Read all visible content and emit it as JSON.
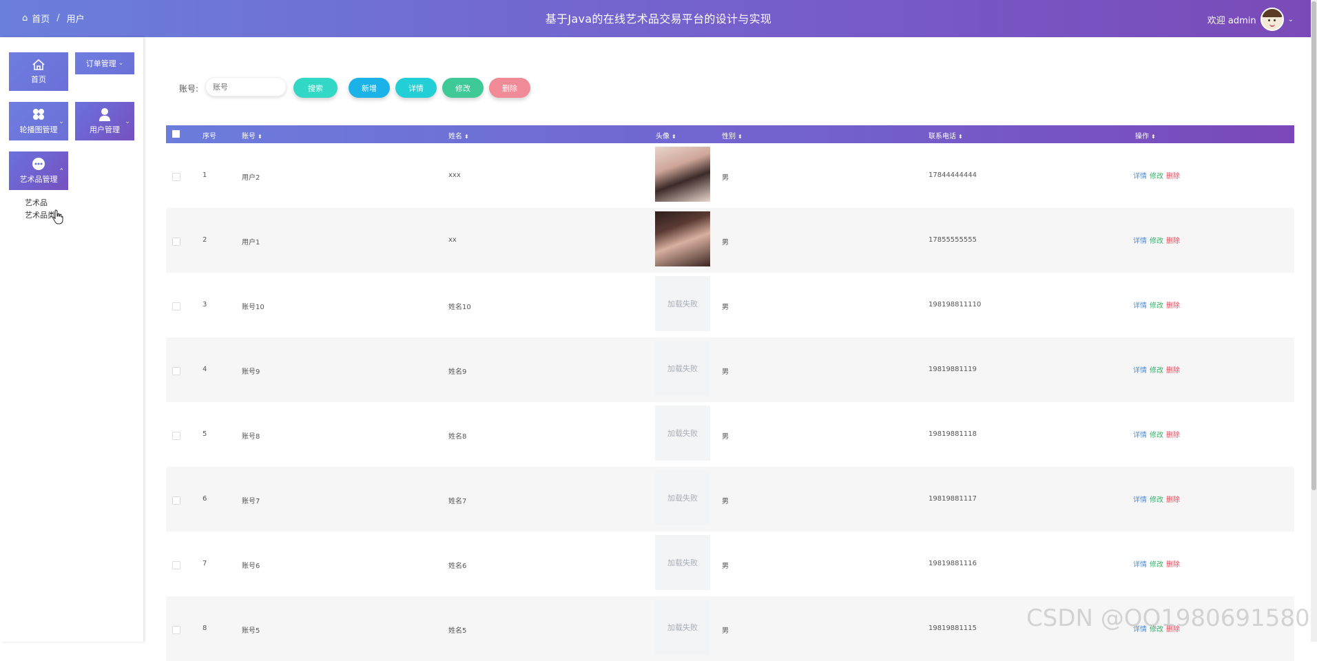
{
  "header": {
    "breadcrumb": {
      "home_glyph": "⌂",
      "home": "首页",
      "separator": "/",
      "current": "用户"
    },
    "title": "基于Java的在线艺术品交易平台的设计与实现",
    "welcome": "欢迎 admin",
    "caret": "⌄"
  },
  "sidebar": {
    "home": "首页",
    "orders": "订单管理",
    "carousel": "轮播图管理",
    "users": "用户管理",
    "artworks": "艺术品管理",
    "sub_items": [
      "艺术品",
      "艺术品类"
    ],
    "caret_down": "⌄",
    "caret_up": "⌃"
  },
  "toolbar": {
    "account_label": "账号:",
    "account_placeholder": "账号",
    "search": "搜索",
    "add": "新增",
    "detail": "详情",
    "edit": "修改",
    "delete": "删除"
  },
  "table": {
    "sort_glyph": "⬍",
    "columns": [
      "序号",
      "账号",
      "姓名",
      "头像",
      "性别",
      "联系电话",
      "操作"
    ],
    "rows": [
      {
        "index": "1",
        "account": "用户2",
        "name": "xxx",
        "avatar": "",
        "gender": "男",
        "phone": "17844444444"
      },
      {
        "index": "2",
        "account": "用户1",
        "name": "xx",
        "avatar": "",
        "gender": "男",
        "phone": "17855555555"
      },
      {
        "index": "3",
        "account": "账号10",
        "name": "姓名10",
        "avatar": "加载失败",
        "gender": "男",
        "phone": "198198811110"
      },
      {
        "index": "4",
        "account": "账号9",
        "name": "姓名9",
        "avatar": "加载失败",
        "gender": "男",
        "phone": "19819881119"
      },
      {
        "index": "5",
        "account": "账号8",
        "name": "姓名8",
        "avatar": "加载失败",
        "gender": "男",
        "phone": "19819881118"
      },
      {
        "index": "6",
        "account": "账号7",
        "name": "姓名7",
        "avatar": "加载失败",
        "gender": "男",
        "phone": "19819881117"
      },
      {
        "index": "7",
        "account": "账号6",
        "name": "姓名6",
        "avatar": "加载失败",
        "gender": "男",
        "phone": "19819881116"
      },
      {
        "index": "8",
        "account": "账号5",
        "name": "姓名5",
        "avatar": "加载失败",
        "gender": "男",
        "phone": "19819881115"
      }
    ],
    "row_actions": {
      "detail": "详情",
      "edit": "修改",
      "delete": "删除"
    }
  },
  "watermark": "CSDN @QQ1980691580"
}
